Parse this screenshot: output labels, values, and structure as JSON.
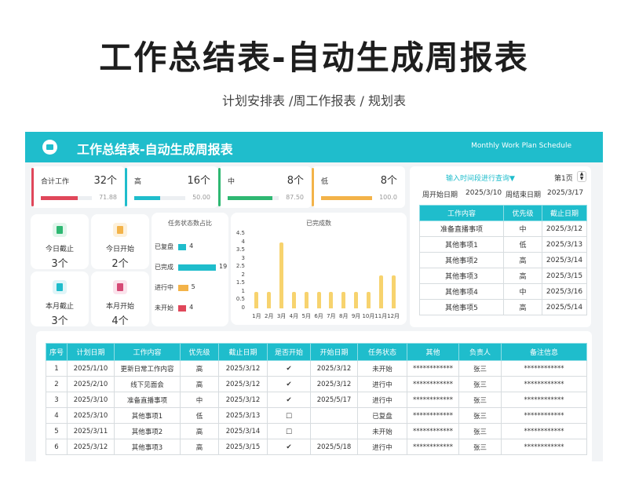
{
  "hero": {
    "title": "工作总结表-自动生成周报表",
    "subtitle": "计划安排表 /周工作报表 / 规划表"
  },
  "banner": {
    "title": "工作总结表-自动生成周报表",
    "subtitle_en": "Monthly Work Plan Schedule",
    "icon": "briefcase-icon"
  },
  "kpis": [
    {
      "label": "合计工作",
      "count": "32个",
      "value": "71.88",
      "fraction": 0.7188,
      "color": "#e0475a"
    },
    {
      "label": "高",
      "count": "16个",
      "value": "50.00",
      "fraction": 0.5,
      "color": "#1fbdcc"
    },
    {
      "label": "中",
      "count": "8个",
      "value": "87.50",
      "fraction": 0.875,
      "color": "#2eb872"
    },
    {
      "label": "低",
      "count": "8个",
      "value": "100.0",
      "fraction": 1.0,
      "color": "#f3b349"
    }
  ],
  "summary_cards": [
    {
      "label": "今日截止",
      "value": "3个",
      "icon": "book-icon",
      "icon_color": "#2eb872",
      "icon_bg": "#e2f6ec"
    },
    {
      "label": "今日开始",
      "value": "2个",
      "icon": "layers-icon",
      "icon_color": "#f3b349",
      "icon_bg": "#fdf1dc"
    },
    {
      "label": "本月截止",
      "value": "3个",
      "icon": "bar-chart-icon",
      "icon_color": "#1fbdcc",
      "icon_bg": "#dff5f8"
    },
    {
      "label": "本月开始",
      "value": "4个",
      "icon": "bar-chart-icon",
      "icon_color": "#d64a76",
      "icon_bg": "#fbe3ec"
    }
  ],
  "status_chart": {
    "title": "任务状态数占比",
    "type": "bar",
    "categories": [
      "已复盘",
      "已完成",
      "进行中",
      "未开始"
    ],
    "values": [
      4,
      19,
      5,
      4
    ],
    "colors": [
      "#1fbdcc",
      "#1fbdcc",
      "#f3b349",
      "#e0475a"
    ],
    "max": 19
  },
  "chart_data": {
    "type": "bar",
    "title": "已完成数",
    "categories": [
      "1月",
      "2月",
      "3月",
      "4月",
      "5月",
      "6月",
      "7月",
      "8月",
      "9月",
      "10月",
      "11月",
      "12月"
    ],
    "values": [
      1,
      1,
      4,
      1,
      1,
      1,
      1,
      1,
      1,
      1,
      2,
      2
    ],
    "yticks": [
      "4.5",
      "4",
      "3.5",
      "3",
      "2.5",
      "2",
      "1.5",
      "1",
      "0.5",
      "0"
    ],
    "ylim": [
      0,
      4.5
    ],
    "grid": false,
    "color": "#f7d36e"
  },
  "query_panel": {
    "query_link": "输入时间段进行查询▼",
    "page_label": "第1页",
    "start_label": "周开始日期",
    "start_value": "2025/3/10",
    "end_label": "周结束日期",
    "end_value": "2025/3/17",
    "headers": [
      "工作内容",
      "优先级",
      "截止日期"
    ],
    "rows": [
      [
        "准备直播事项",
        "中",
        "2025/3/12"
      ],
      [
        "其他事项1",
        "低",
        "2025/3/13"
      ],
      [
        "其他事项2",
        "高",
        "2025/3/14"
      ],
      [
        "其他事项3",
        "高",
        "2025/3/15"
      ],
      [
        "其他事项4",
        "中",
        "2025/3/16"
      ],
      [
        "其他事项5",
        "高",
        "2025/5/14"
      ]
    ]
  },
  "main_table": {
    "headers": [
      "序号",
      "计划日期",
      "工作内容",
      "优先级",
      "截止日期",
      "是否开始",
      "开始日期",
      "任务状态",
      "其他",
      "负责人",
      "备注信息"
    ],
    "rows": [
      [
        "1",
        "2025/1/10",
        "更新日常工作内容",
        "高",
        "2025/3/12",
        "✔",
        "2025/3/12",
        "未开始",
        "************",
        "张三",
        "************"
      ],
      [
        "2",
        "2025/2/10",
        "线下见面会",
        "高",
        "2025/3/12",
        "✔",
        "2025/3/12",
        "进行中",
        "************",
        "张三",
        "************"
      ],
      [
        "3",
        "2025/3/10",
        "准备直播事项",
        "中",
        "2025/3/12",
        "✔",
        "2025/5/17",
        "进行中",
        "************",
        "张三",
        "************"
      ],
      [
        "4",
        "2025/3/10",
        "其他事项1",
        "低",
        "2025/3/13",
        "□",
        "",
        "已复盘",
        "************",
        "张三",
        "************"
      ],
      [
        "5",
        "2025/3/11",
        "其他事项2",
        "高",
        "2025/3/14",
        "□",
        "",
        "未开始",
        "************",
        "张三",
        "************"
      ],
      [
        "6",
        "2025/3/12",
        "其他事项3",
        "高",
        "2025/3/15",
        "✔",
        "2025/5/18",
        "进行中",
        "************",
        "张三",
        "************"
      ]
    ]
  }
}
